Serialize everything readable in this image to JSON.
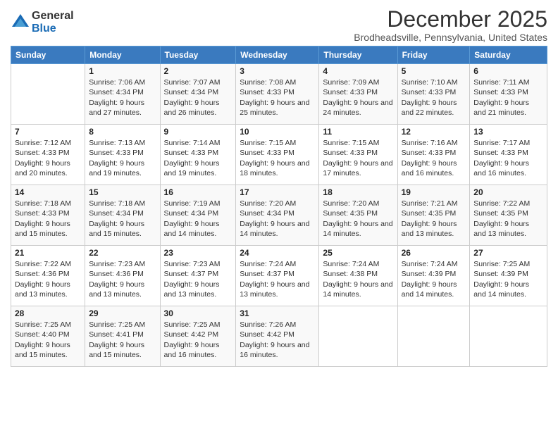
{
  "logo": {
    "general": "General",
    "blue": "Blue"
  },
  "title": "December 2025",
  "subtitle": "Brodheadsville, Pennsylvania, United States",
  "days_header": [
    "Sunday",
    "Monday",
    "Tuesday",
    "Wednesday",
    "Thursday",
    "Friday",
    "Saturday"
  ],
  "weeks": [
    [
      {
        "num": "",
        "sunrise": "",
        "sunset": "",
        "daylight": ""
      },
      {
        "num": "1",
        "sunrise": "Sunrise: 7:06 AM",
        "sunset": "Sunset: 4:34 PM",
        "daylight": "Daylight: 9 hours and 27 minutes."
      },
      {
        "num": "2",
        "sunrise": "Sunrise: 7:07 AM",
        "sunset": "Sunset: 4:34 PM",
        "daylight": "Daylight: 9 hours and 26 minutes."
      },
      {
        "num": "3",
        "sunrise": "Sunrise: 7:08 AM",
        "sunset": "Sunset: 4:33 PM",
        "daylight": "Daylight: 9 hours and 25 minutes."
      },
      {
        "num": "4",
        "sunrise": "Sunrise: 7:09 AM",
        "sunset": "Sunset: 4:33 PM",
        "daylight": "Daylight: 9 hours and 24 minutes."
      },
      {
        "num": "5",
        "sunrise": "Sunrise: 7:10 AM",
        "sunset": "Sunset: 4:33 PM",
        "daylight": "Daylight: 9 hours and 22 minutes."
      },
      {
        "num": "6",
        "sunrise": "Sunrise: 7:11 AM",
        "sunset": "Sunset: 4:33 PM",
        "daylight": "Daylight: 9 hours and 21 minutes."
      }
    ],
    [
      {
        "num": "7",
        "sunrise": "Sunrise: 7:12 AM",
        "sunset": "Sunset: 4:33 PM",
        "daylight": "Daylight: 9 hours and 20 minutes."
      },
      {
        "num": "8",
        "sunrise": "Sunrise: 7:13 AM",
        "sunset": "Sunset: 4:33 PM",
        "daylight": "Daylight: 9 hours and 19 minutes."
      },
      {
        "num": "9",
        "sunrise": "Sunrise: 7:14 AM",
        "sunset": "Sunset: 4:33 PM",
        "daylight": "Daylight: 9 hours and 19 minutes."
      },
      {
        "num": "10",
        "sunrise": "Sunrise: 7:15 AM",
        "sunset": "Sunset: 4:33 PM",
        "daylight": "Daylight: 9 hours and 18 minutes."
      },
      {
        "num": "11",
        "sunrise": "Sunrise: 7:15 AM",
        "sunset": "Sunset: 4:33 PM",
        "daylight": "Daylight: 9 hours and 17 minutes."
      },
      {
        "num": "12",
        "sunrise": "Sunrise: 7:16 AM",
        "sunset": "Sunset: 4:33 PM",
        "daylight": "Daylight: 9 hours and 16 minutes."
      },
      {
        "num": "13",
        "sunrise": "Sunrise: 7:17 AM",
        "sunset": "Sunset: 4:33 PM",
        "daylight": "Daylight: 9 hours and 16 minutes."
      }
    ],
    [
      {
        "num": "14",
        "sunrise": "Sunrise: 7:18 AM",
        "sunset": "Sunset: 4:33 PM",
        "daylight": "Daylight: 9 hours and 15 minutes."
      },
      {
        "num": "15",
        "sunrise": "Sunrise: 7:18 AM",
        "sunset": "Sunset: 4:34 PM",
        "daylight": "Daylight: 9 hours and 15 minutes."
      },
      {
        "num": "16",
        "sunrise": "Sunrise: 7:19 AM",
        "sunset": "Sunset: 4:34 PM",
        "daylight": "Daylight: 9 hours and 14 minutes."
      },
      {
        "num": "17",
        "sunrise": "Sunrise: 7:20 AM",
        "sunset": "Sunset: 4:34 PM",
        "daylight": "Daylight: 9 hours and 14 minutes."
      },
      {
        "num": "18",
        "sunrise": "Sunrise: 7:20 AM",
        "sunset": "Sunset: 4:35 PM",
        "daylight": "Daylight: 9 hours and 14 minutes."
      },
      {
        "num": "19",
        "sunrise": "Sunrise: 7:21 AM",
        "sunset": "Sunset: 4:35 PM",
        "daylight": "Daylight: 9 hours and 13 minutes."
      },
      {
        "num": "20",
        "sunrise": "Sunrise: 7:22 AM",
        "sunset": "Sunset: 4:35 PM",
        "daylight": "Daylight: 9 hours and 13 minutes."
      }
    ],
    [
      {
        "num": "21",
        "sunrise": "Sunrise: 7:22 AM",
        "sunset": "Sunset: 4:36 PM",
        "daylight": "Daylight: 9 hours and 13 minutes."
      },
      {
        "num": "22",
        "sunrise": "Sunrise: 7:23 AM",
        "sunset": "Sunset: 4:36 PM",
        "daylight": "Daylight: 9 hours and 13 minutes."
      },
      {
        "num": "23",
        "sunrise": "Sunrise: 7:23 AM",
        "sunset": "Sunset: 4:37 PM",
        "daylight": "Daylight: 9 hours and 13 minutes."
      },
      {
        "num": "24",
        "sunrise": "Sunrise: 7:24 AM",
        "sunset": "Sunset: 4:37 PM",
        "daylight": "Daylight: 9 hours and 13 minutes."
      },
      {
        "num": "25",
        "sunrise": "Sunrise: 7:24 AM",
        "sunset": "Sunset: 4:38 PM",
        "daylight": "Daylight: 9 hours and 14 minutes."
      },
      {
        "num": "26",
        "sunrise": "Sunrise: 7:24 AM",
        "sunset": "Sunset: 4:39 PM",
        "daylight": "Daylight: 9 hours and 14 minutes."
      },
      {
        "num": "27",
        "sunrise": "Sunrise: 7:25 AM",
        "sunset": "Sunset: 4:39 PM",
        "daylight": "Daylight: 9 hours and 14 minutes."
      }
    ],
    [
      {
        "num": "28",
        "sunrise": "Sunrise: 7:25 AM",
        "sunset": "Sunset: 4:40 PM",
        "daylight": "Daylight: 9 hours and 15 minutes."
      },
      {
        "num": "29",
        "sunrise": "Sunrise: 7:25 AM",
        "sunset": "Sunset: 4:41 PM",
        "daylight": "Daylight: 9 hours and 15 minutes."
      },
      {
        "num": "30",
        "sunrise": "Sunrise: 7:25 AM",
        "sunset": "Sunset: 4:42 PM",
        "daylight": "Daylight: 9 hours and 16 minutes."
      },
      {
        "num": "31",
        "sunrise": "Sunrise: 7:26 AM",
        "sunset": "Sunset: 4:42 PM",
        "daylight": "Daylight: 9 hours and 16 minutes."
      },
      {
        "num": "",
        "sunrise": "",
        "sunset": "",
        "daylight": ""
      },
      {
        "num": "",
        "sunrise": "",
        "sunset": "",
        "daylight": ""
      },
      {
        "num": "",
        "sunrise": "",
        "sunset": "",
        "daylight": ""
      }
    ]
  ]
}
